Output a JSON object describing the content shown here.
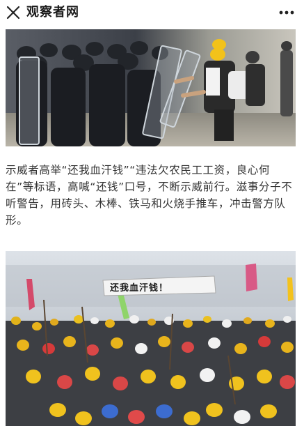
{
  "header": {
    "title": "观察者网",
    "close_icon": "close-icon",
    "more_icon": "more-icon"
  },
  "article": {
    "caption": "示威者高举“还我血汗钱”“违法欠农民工工资，良心何在”等标语，高喊“还钱”口号，不断示威前行。滋事分子不听警告，用砖头、木棒、铁马和火烧手推车，冲击警方队形。",
    "photo2_banner_text": "还我血汗钱！"
  },
  "colors": {
    "header_bg": "#ffffff",
    "text": "#333333",
    "icon": "#222222"
  }
}
